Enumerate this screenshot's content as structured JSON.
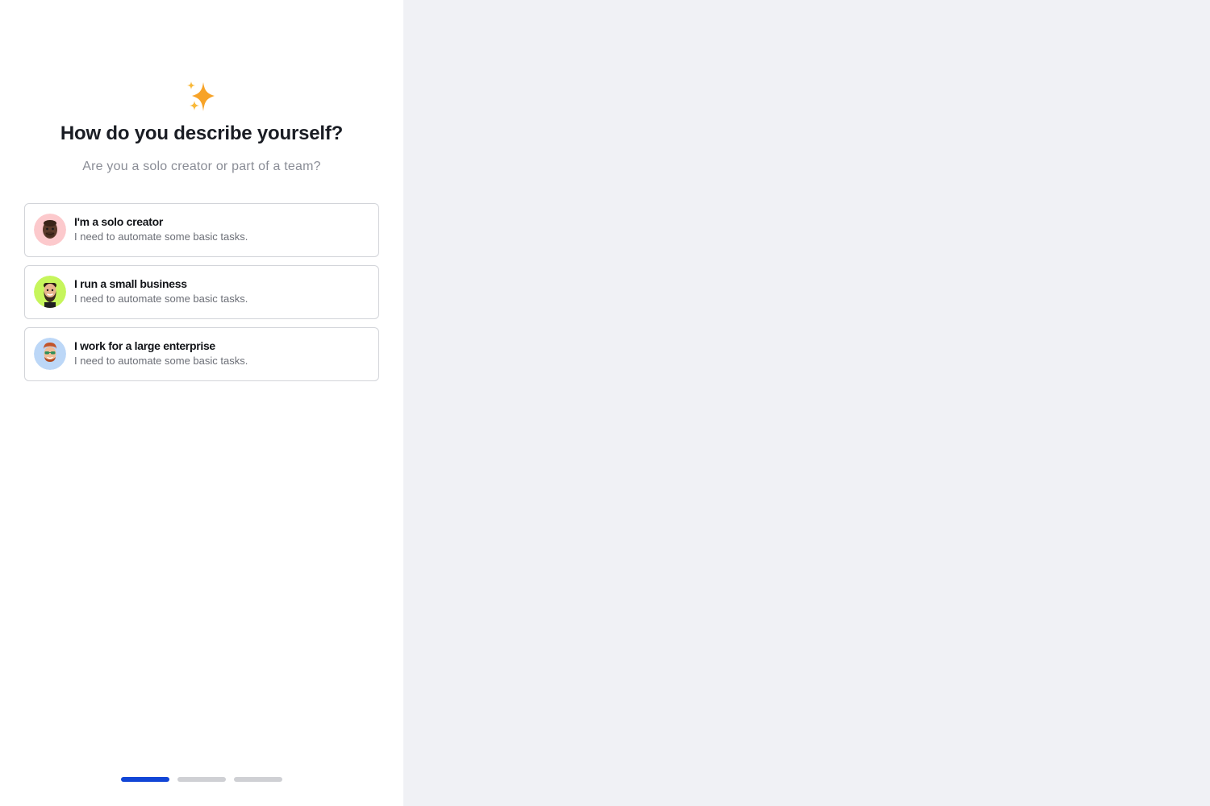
{
  "header": {
    "icon": "sparkles-icon",
    "title": "How do you describe yourself?",
    "subtitle": "Are you a solo creator or part of a team?"
  },
  "options": [
    {
      "title": "I'm a solo creator",
      "description": "I need to automate some basic tasks.",
      "avatar_icon": "memoji-avatar-icon",
      "avatar_bg": "#fcc9cc"
    },
    {
      "title": "I run a small business",
      "description": "I need to automate some basic tasks.",
      "avatar_icon": "memoji-avatar-icon",
      "avatar_bg": "#c6f55c"
    },
    {
      "title": "I work for a large enterprise",
      "description": "I need to automate some basic tasks.",
      "avatar_icon": "memoji-avatar-icon",
      "avatar_bg": "#bcd7f7"
    }
  ],
  "progress": {
    "total_steps": 3,
    "current_step": 1,
    "active_color": "#1145d6",
    "inactive_color": "#cfd0d4"
  },
  "colors": {
    "right_panel_bg": "#f0f1f5",
    "sparkle": "#f5a623"
  }
}
